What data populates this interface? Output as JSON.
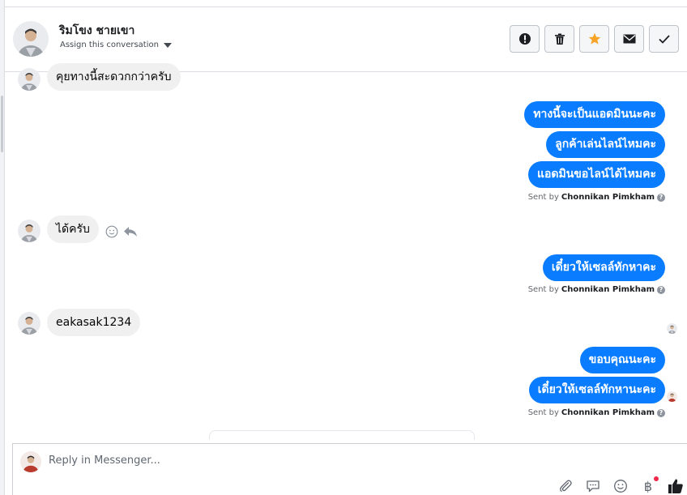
{
  "header": {
    "contact_name": "ริมโขง ชายเขา",
    "assign_label": "Assign this conversation"
  },
  "actions": [
    {
      "name": "spam",
      "icon": "alert-icon"
    },
    {
      "name": "delete",
      "icon": "trash-icon"
    },
    {
      "name": "star",
      "icon": "star-icon"
    },
    {
      "name": "mark-unread",
      "icon": "envelope-icon"
    },
    {
      "name": "done",
      "icon": "check-icon"
    }
  ],
  "messages": {
    "in_1": "คุยทางนี้สะดวกกว่าครับ",
    "out_1": "ทางนี้จะเป็นแอดมินนะคะ",
    "out_2": "ลูกค้าเล่นไลน์ไหมคะ",
    "out_3": "แอดมินขอไลน์ได้ไหมคะ",
    "in_2": "ได้ครับ",
    "out_4": "เดี๋ยวให้เซลล์ทักหาคะ",
    "in_3": "eakasak1234",
    "out_5": "ขอบคุณนะคะ",
    "out_6": "เดี๋ยวให้เซลล์ทักหานะคะ"
  },
  "sent_by": {
    "prefix": "Sent by",
    "agent": "Chonnikan Pimkham"
  },
  "composer": {
    "placeholder": "Reply in Messenger..."
  },
  "colors": {
    "outgoing_bubble": "#0a7cff",
    "incoming_bubble": "#f0f0f0",
    "star": "#f7a325",
    "notification_dot": "#f02849"
  }
}
